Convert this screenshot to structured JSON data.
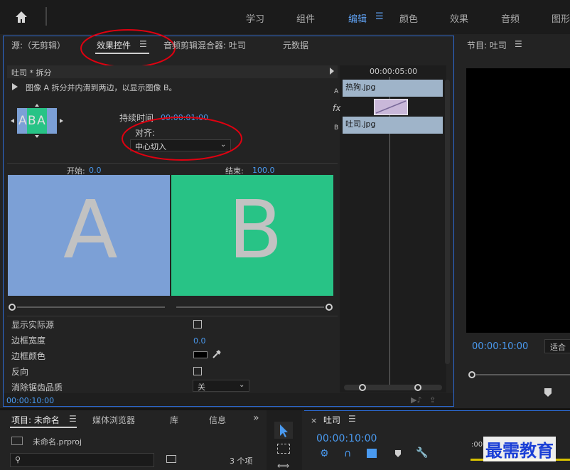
{
  "workspaces": {
    "items": [
      "学习",
      "组件",
      "编辑",
      "颜色",
      "效果",
      "音频",
      "图形"
    ],
    "active": "编辑",
    "menu_glyph": "☰"
  },
  "effect_controls": {
    "tabs": {
      "source": "源:（无剪辑）",
      "effects": "效果控件",
      "audio_mixer": "音频剪辑混合器: 吐司",
      "metadata": "元数据"
    },
    "clip_header": "吐司 * 拆分",
    "description": "图像 A 拆分并内滑到两边，以显示图像 B。",
    "thumb_label": "A B A",
    "duration_label": "持续时间",
    "duration_value": "00:00:01:00",
    "align_label": "对齐:",
    "align_value": "中心切入",
    "start_label": "开始:",
    "start_value": "0.0",
    "end_label": "结束:",
    "end_value": "100.0",
    "preview_a": "A",
    "preview_b": "B",
    "properties": {
      "show_actual": "显示实际源",
      "border_width": "边框宽度",
      "border_width_value": "0.0",
      "border_color": "边框颜色",
      "reverse": "反向",
      "antialias": "消除锯齿品质",
      "antialias_value": "关"
    },
    "timecode": "00:00:10:00",
    "mini_timeline": {
      "ruler": "00:00:05:00",
      "clip_a": "热狗.jpg",
      "clip_b": "吐司.jpg",
      "track_a": "A",
      "track_b": "B",
      "fx": "fx"
    },
    "colors": {
      "a_bg": "#7ca0d6",
      "b_bg": "#28c386",
      "accent": "#4a9af0"
    }
  },
  "program": {
    "title": "节目: 吐司",
    "timecode": "00:00:10:00",
    "fit": "适合"
  },
  "project": {
    "tabs": [
      "项目: 未命名",
      "媒体浏览器",
      "库",
      "信息"
    ],
    "more": "»",
    "file": "未命名.prproj",
    "count": "3 个项"
  },
  "timeline": {
    "title": "吐司",
    "timecode": "00:00:10:00",
    "ruler_hint": ":00"
  },
  "watermark": "最需教育"
}
